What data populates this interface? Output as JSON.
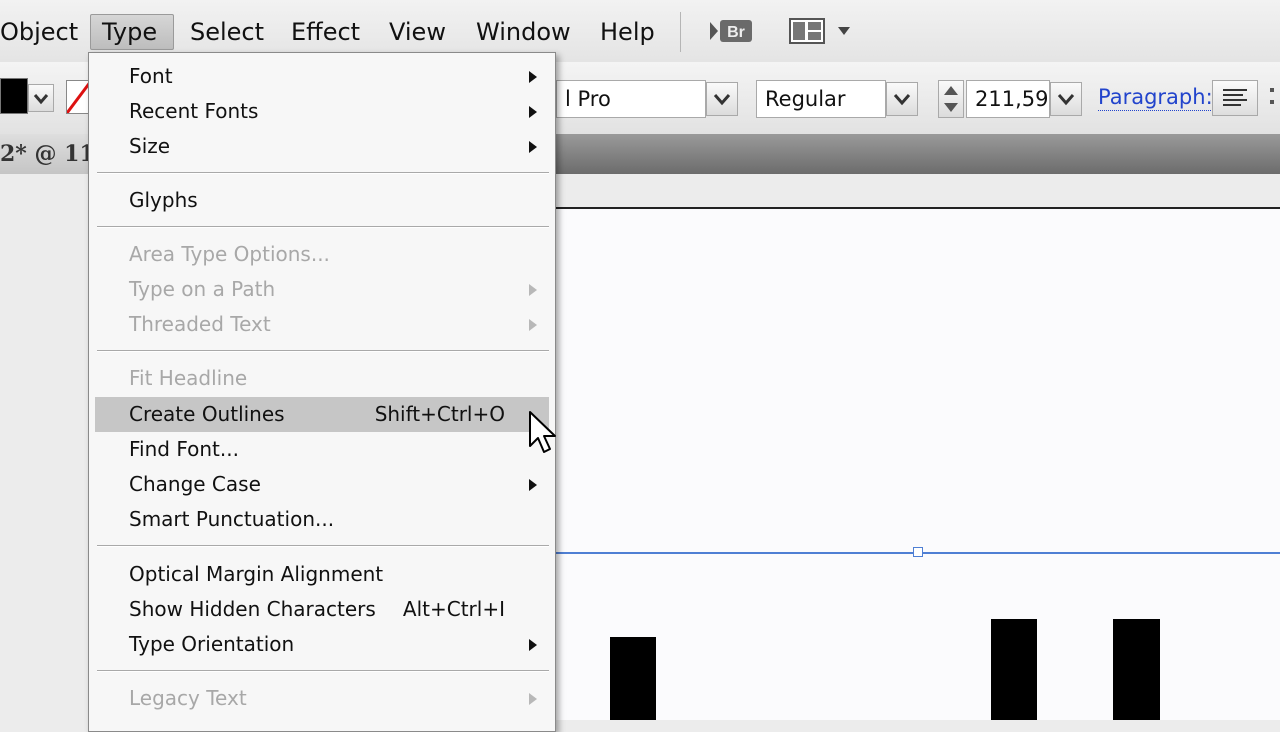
{
  "menubar": {
    "items": [
      "Object",
      "Type",
      "Select",
      "Effect",
      "View",
      "Window",
      "Help"
    ],
    "bridge_label": "Br"
  },
  "controlbar": {
    "font_family_value": "l Pro",
    "font_style_value": "Regular",
    "font_size_value": "211,59",
    "paragraph_label": "Paragraph:"
  },
  "document_tab": {
    "title": "2* @ 11"
  },
  "type_menu": {
    "items": [
      {
        "label": "Font",
        "shortcut": "",
        "submenu": true,
        "enabled": true
      },
      {
        "label": "Recent Fonts",
        "shortcut": "",
        "submenu": true,
        "enabled": true
      },
      {
        "label": "Size",
        "shortcut": "",
        "submenu": true,
        "enabled": true
      },
      {
        "label": "Glyphs",
        "shortcut": "",
        "submenu": false,
        "enabled": true
      },
      {
        "label": "Area Type Options...",
        "shortcut": "",
        "submenu": false,
        "enabled": false
      },
      {
        "label": "Type on a Path",
        "shortcut": "",
        "submenu": true,
        "enabled": false
      },
      {
        "label": "Threaded Text",
        "shortcut": "",
        "submenu": true,
        "enabled": false
      },
      {
        "label": "Fit Headline",
        "shortcut": "",
        "submenu": false,
        "enabled": false
      },
      {
        "label": "Create Outlines",
        "shortcut": "Shift+Ctrl+O",
        "submenu": false,
        "enabled": true,
        "highlighted": true
      },
      {
        "label": "Find Font...",
        "shortcut": "",
        "submenu": false,
        "enabled": true
      },
      {
        "label": "Change Case",
        "shortcut": "",
        "submenu": true,
        "enabled": true
      },
      {
        "label": "Smart Punctuation...",
        "shortcut": "",
        "submenu": false,
        "enabled": true
      },
      {
        "label": "Optical Margin Alignment",
        "shortcut": "",
        "submenu": false,
        "enabled": true
      },
      {
        "label": "Show Hidden Characters",
        "shortcut": "Alt+Ctrl+I",
        "submenu": false,
        "enabled": true
      },
      {
        "label": "Type Orientation",
        "shortcut": "",
        "submenu": true,
        "enabled": true
      },
      {
        "label": "Legacy Text",
        "shortcut": "",
        "submenu": true,
        "enabled": false
      }
    ]
  },
  "colors": {
    "highlight": "#c6c6c6",
    "disabled_text": "#a8a8a8",
    "selection_blue": "#4f7fd4",
    "link_blue": "#2244cc"
  },
  "icons": [
    "chevron-down-icon",
    "bridge-icon",
    "arrange-documents-icon",
    "submenu-arrow-icon",
    "align-left-icon",
    "mouse-pointer-icon",
    "stroke-swatch-icon"
  ]
}
